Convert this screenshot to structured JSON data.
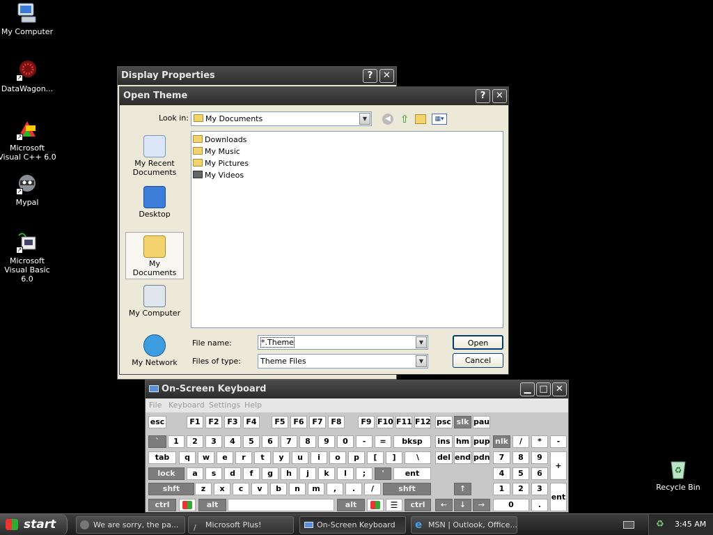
{
  "desktop": {
    "icons": [
      {
        "label": "My Computer"
      },
      {
        "label": "DataWagon..."
      },
      {
        "label": "Microsoft Visual C++ 6.0"
      },
      {
        "label": "Mypal"
      },
      {
        "label": "Microsoft Visual Basic 6.0"
      },
      {
        "label": "Recycle Bin"
      }
    ]
  },
  "display_properties": {
    "title": "Display Properties",
    "help_label": "?",
    "close_label": "✕"
  },
  "open_theme": {
    "title": "Open Theme",
    "help_label": "?",
    "close_label": "✕",
    "look_in_label": "Look in:",
    "look_in_value": "My Documents",
    "places": [
      {
        "label": "My Recent Documents"
      },
      {
        "label": "Desktop"
      },
      {
        "label": "My Documents"
      },
      {
        "label": "My Computer"
      },
      {
        "label": "My Network"
      }
    ],
    "files": [
      "Downloads",
      "My Music",
      "My Pictures",
      "My Videos"
    ],
    "file_name_label": "File name:",
    "file_name_value": "*.Theme",
    "file_type_label": "Files of type:",
    "file_type_value": "Theme Files",
    "open_label": "Open",
    "cancel_label": "Cancel"
  },
  "osk": {
    "title": "On-Screen Keyboard",
    "menu": [
      "File",
      "Keyboard",
      "Settings",
      "Help"
    ],
    "minimize_label": "▁",
    "maximize_label": "□",
    "close_label": "✕",
    "keys": {
      "row0": [
        "esc",
        "F1",
        "F2",
        "F3",
        "F4",
        "F5",
        "F6",
        "F7",
        "F8",
        "F9",
        "F10",
        "F11",
        "F12",
        "psc",
        "slk",
        "pau"
      ],
      "row1": [
        "`",
        "1",
        "2",
        "3",
        "4",
        "5",
        "6",
        "7",
        "8",
        "9",
        "0",
        "-",
        "=",
        "bksp",
        "ins",
        "hm",
        "pup",
        "nlk",
        "/",
        "*",
        "-"
      ],
      "row2": [
        "tab",
        "q",
        "w",
        "e",
        "r",
        "t",
        "y",
        "u",
        "i",
        "o",
        "p",
        "[",
        "]",
        "\\",
        "del",
        "end",
        "pdn",
        "7",
        "8",
        "9",
        "+"
      ],
      "row3": [
        "lock",
        "a",
        "s",
        "d",
        "f",
        "g",
        "h",
        "j",
        "k",
        "l",
        ";",
        "'",
        "ent",
        "4",
        "5",
        "6"
      ],
      "row4": [
        "shft",
        "z",
        "x",
        "c",
        "v",
        "b",
        "n",
        "m",
        ",",
        ".",
        "/",
        "shft",
        "↑",
        "1",
        "2",
        "3",
        "ent"
      ],
      "row5": [
        "ctrl",
        "alt",
        "alt",
        "ctrl",
        "←",
        "↓",
        "→",
        "0",
        "."
      ]
    }
  },
  "taskbar": {
    "start_label": "start",
    "tasks": [
      {
        "label": "We are sorry, the pa..."
      },
      {
        "label": "Microsoft Plus!"
      },
      {
        "label": "On-Screen Keyboard"
      },
      {
        "label": "MSN | Outlook, Office..."
      }
    ],
    "clock": "3:45 AM"
  }
}
